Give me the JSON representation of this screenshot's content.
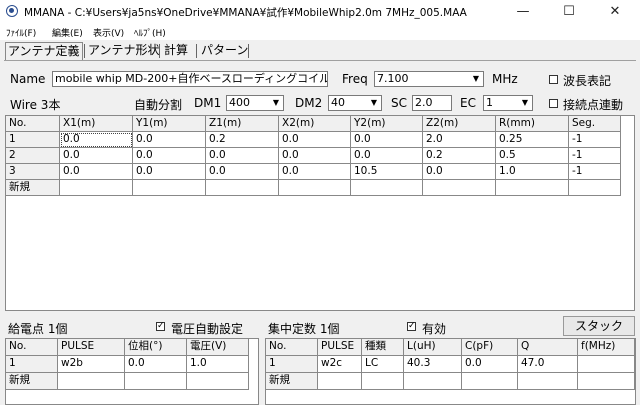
{
  "window": {
    "title": "MMANA - C:¥Users¥ja5ns¥OneDrive¥MMANA¥試作¥MobileWhip2.0m 7MHz_005.MAA",
    "minimize": "—",
    "maximize": "☐",
    "close": "✕"
  },
  "menu": [
    "ﾌｧｲﾙ(F)",
    "編集(E)",
    "表示(V)",
    "ﾍﾙﾌﾟ(H)"
  ],
  "tabs": [
    "アンテナ定義",
    "アンテナ形状",
    "計算",
    "パターン"
  ],
  "name_label": "Name",
  "name_value": "mobile whip  MD-200+自作ベースローディングコイル",
  "freq_label": "Freq",
  "freq_value": "7.100",
  "freq_unit": "MHz",
  "wavelength_label": "波長表記",
  "wire_count": "Wire 3本",
  "auto_split_label": "自動分割",
  "dm1_label": "DM1",
  "dm1_value": "400",
  "dm2_label": "DM2",
  "dm2_value": "40",
  "sc_label": "SC",
  "sc_value": "2.0",
  "ec_label": "EC",
  "ec_value": "1",
  "connect_label": "接続点連動",
  "wire_table": {
    "headers": [
      "No.",
      "X1(m)",
      "Y1(m)",
      "Z1(m)",
      "X2(m)",
      "Y2(m)",
      "Z2(m)",
      "R(mm)",
      "Seg."
    ],
    "rows": [
      [
        "1",
        "0.0",
        "0.0",
        "0.2",
        "0.0",
        "0.0",
        "2.0",
        "0.25",
        "-1"
      ],
      [
        "2",
        "0.0",
        "0.0",
        "0.0",
        "0.0",
        "0.0",
        "0.2",
        "0.5",
        "-1"
      ],
      [
        "3",
        "0.0",
        "0.0",
        "0.0",
        "0.0",
        "10.5",
        "0.0",
        "1.0",
        "-1"
      ]
    ],
    "new_label": "新規"
  },
  "feed": {
    "title": "給電点 1個",
    "auto_voltage_label": "電圧自動設定",
    "headers": [
      "No.",
      "PULSE",
      "位相(°)",
      "電圧(V)"
    ],
    "rows": [
      [
        "1",
        "w2b",
        "0.0",
        "1.0"
      ]
    ],
    "new_label": "新規"
  },
  "lumped": {
    "title": "集中定数 1個",
    "enable_label": "有効",
    "stack_label": "スタック",
    "headers": [
      "No.",
      "PULSE",
      "種類",
      "L(uH)",
      "C(pF)",
      "Q",
      "f(MHz)"
    ],
    "rows": [
      [
        "1",
        "w2c",
        "LC",
        "40.3",
        "0.0",
        "47.0",
        ""
      ]
    ],
    "new_label": "新規"
  }
}
